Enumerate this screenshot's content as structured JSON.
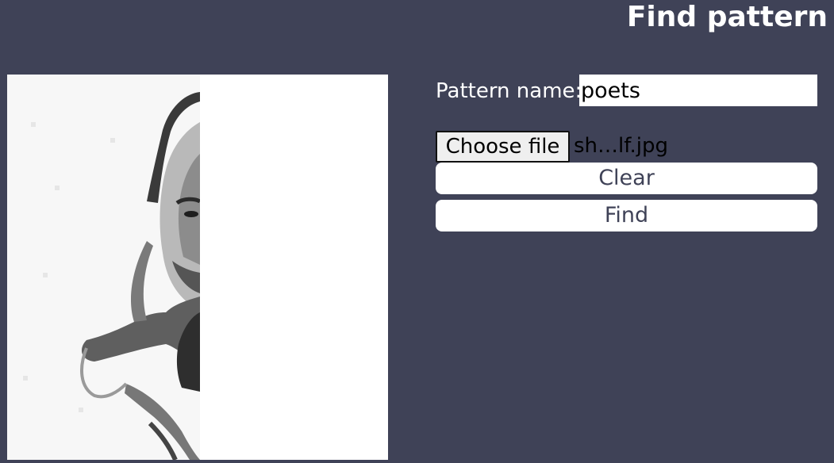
{
  "header": {
    "title": "Find pattern"
  },
  "preview": {
    "icon": "portrait-photo-preview"
  },
  "form": {
    "pattern_label": "Pattern name:",
    "pattern_value": "poets",
    "file_button_label": "Choose file",
    "file_name": "sh…lf.jpg",
    "clear_label": "Clear",
    "find_label": "Find"
  },
  "colors": {
    "background": "#3f4257",
    "button_bg": "#ffffff",
    "button_text": "#3f4257"
  }
}
